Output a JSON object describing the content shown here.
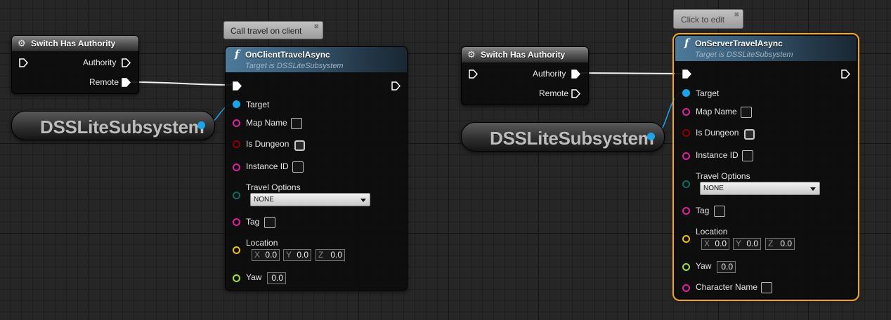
{
  "colors": {
    "exec": "#ffffff",
    "object": "#1ca4e8",
    "string": "#e0209e",
    "bool": "#7c0000",
    "byte": "#0e6a62",
    "vector": "#f0c020",
    "float": "#a0e040",
    "selection": "#f3a325"
  },
  "left": {
    "switch": {
      "title": "Switch Has Authority",
      "authority": "Authority",
      "remote": "Remote"
    },
    "variable": {
      "name": "DSSLiteSubsystem"
    },
    "comment": "Call travel on client",
    "func": {
      "title": "OnClientTravelAsync",
      "subtitle": "Target is DSSLiteSubsystem",
      "target": "Target",
      "map_name": "Map Name",
      "is_dungeon": "Is Dungeon",
      "instance_id": "Instance ID",
      "travel_options": "Travel Options",
      "travel_value": "NONE",
      "tag": "Tag",
      "location": "Location",
      "x_axis": "X",
      "x_val": "0.0",
      "y_axis": "Y",
      "y_val": "0.0",
      "z_axis": "Z",
      "z_val": "0.0",
      "yaw": "Yaw",
      "yaw_val": "0.0"
    }
  },
  "right": {
    "switch": {
      "title": "Switch Has Authority",
      "authority": "Authority",
      "remote": "Remote"
    },
    "variable": {
      "name": "DSSLiteSubsystem"
    },
    "comment": "Click to edit",
    "func": {
      "title": "OnServerTravelAsync",
      "subtitle": "Target is DSSLiteSubsystem",
      "target": "Target",
      "map_name": "Map Name",
      "is_dungeon": "Is Dungeon",
      "instance_id": "Instance ID",
      "travel_options": "Travel Options",
      "travel_value": "NONE",
      "tag": "Tag",
      "location": "Location",
      "x_axis": "X",
      "x_val": "0.0",
      "y_axis": "Y",
      "y_val": "0.0",
      "z_axis": "Z",
      "z_val": "0.0",
      "yaw": "Yaw",
      "yaw_val": "0.0",
      "character_name": "Character Name"
    }
  },
  "icons": {
    "function": "function-f-icon",
    "macro": "gear-icon",
    "comment_pin": "pin-icon"
  }
}
